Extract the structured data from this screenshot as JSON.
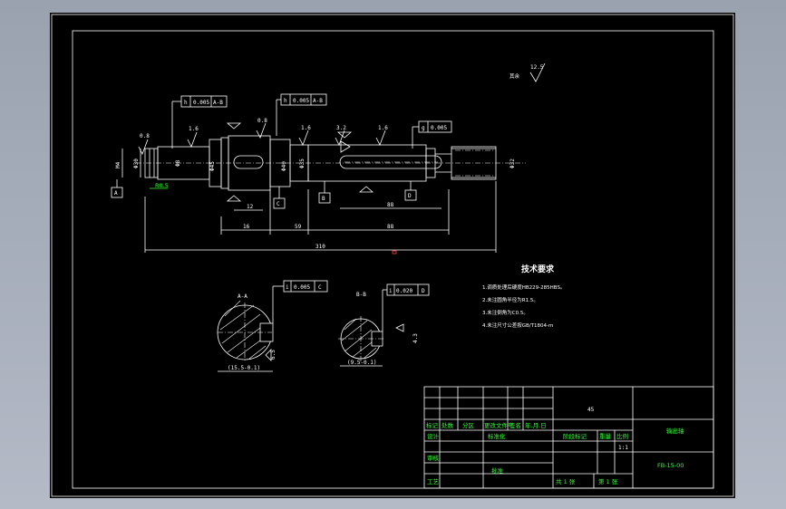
{
  "colors": {
    "background": "#000000",
    "lines": "#ffffff",
    "annotation": "#33ff33",
    "highlight": "#ff4444",
    "chrome": "#a9b0bd"
  },
  "roughness": {
    "main": "12.5",
    "label": "其余"
  },
  "tolerances": {
    "t1": {
      "sym": "h",
      "val": "0.005",
      "ref": "A-B"
    },
    "t2": {
      "sym": "h",
      "val": "0.005",
      "ref": "A-B"
    },
    "t3": {
      "sym": "g",
      "val": "0.005"
    },
    "sec1": {
      "sym": "i",
      "val": "0.005",
      "ref": "C"
    },
    "sec2": {
      "sym": "i",
      "val": "0.020",
      "ref": "D"
    }
  },
  "datums": {
    "a": "A",
    "b": "B",
    "c": "C",
    "d": "D"
  },
  "roughness_marks": [
    "0.8",
    "1.6",
    "0.8",
    "1.6",
    "3.2",
    "1.6",
    "3.2"
  ],
  "dims": {
    "total": "310",
    "seg1": "16",
    "seg2": "59",
    "seg3": "88",
    "seg4": "12",
    "seg5": "88",
    "chamfer": "R0.5",
    "sec1_w": "(15.5-0.1)",
    "sec2_w": "(9.5-0.1)",
    "sec1_k": "6.5",
    "sec2_k": "4.3",
    "m1": "M4",
    "m2": "Φ8",
    "d1": "Φ30",
    "d2": "Φ45",
    "d3": "Φ40",
    "d4": "Φ35",
    "d5": "Φ32"
  },
  "sections": {
    "s1": "A-A",
    "s2": "B-B"
  },
  "tech": {
    "title": "技术要求",
    "items": [
      "1.调质处理后硬度HB229-285HBS。",
      "2.未注圆角半径为R1.5。",
      "3.未注倒角为C0.5。",
      "4.未注尺寸公差按GB/T1804-m"
    ]
  },
  "title_block": {
    "material": "45",
    "part_name": "输出轴",
    "drawing_no": "FB-15-00",
    "header_row": [
      "标记",
      "处数",
      "分区",
      "更改文件号",
      "签名",
      "年.月.日"
    ],
    "design": "设计",
    "standard": "标准化",
    "check": "审核",
    "process": "工艺",
    "approve": "批准",
    "stage": "阶段标记",
    "weight": "重量",
    "scale": "比例",
    "scale_val": "1:1",
    "sheets_total": "共 1 张",
    "sheet_no": "第 1 张"
  }
}
